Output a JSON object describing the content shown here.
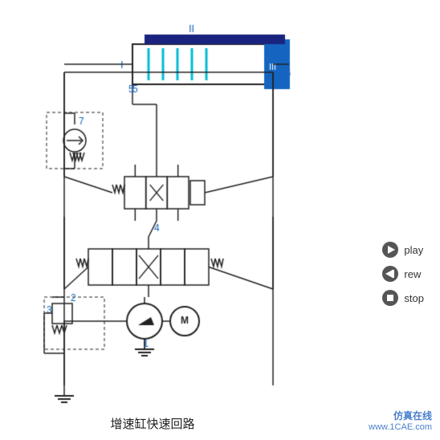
{
  "title": "增速缸快速回路",
  "watermark": {
    "line1": "仿真在线",
    "line2": "www.1CAE.com"
  },
  "controls": {
    "play_label": "play",
    "rew_label": "rew",
    "stop_label": "stop"
  },
  "labels": {
    "I": "I",
    "II": "II",
    "III": "III",
    "n1": "1",
    "n2": "2",
    "n3": "3",
    "n4": "4",
    "n5": "5",
    "n6": "6",
    "n7": "7"
  }
}
